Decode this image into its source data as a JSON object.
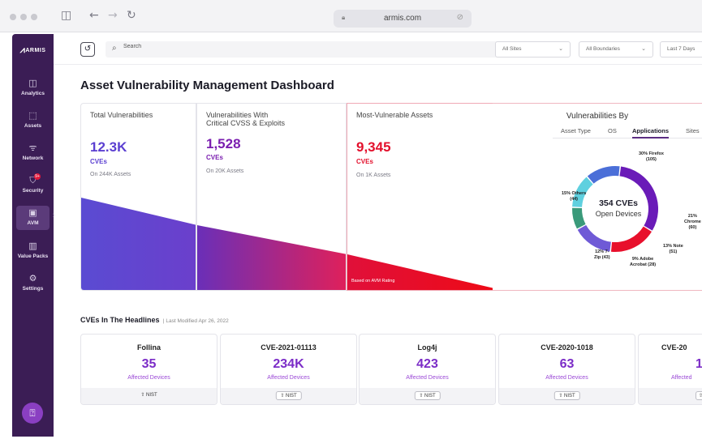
{
  "browser": {
    "url": "armis.com"
  },
  "sidebar": {
    "logo": "ARMIS",
    "items": [
      {
        "label": "Analytics",
        "icon": "chart-icon",
        "glyph": "◫"
      },
      {
        "label": "Assets",
        "icon": "assets-icon",
        "glyph": "⬚"
      },
      {
        "label": "Network",
        "icon": "wifi-icon",
        "glyph": "ᯤ"
      },
      {
        "label": "Security",
        "icon": "shield-icon",
        "glyph": "⛉",
        "badge": "9+"
      },
      {
        "label": "AVM",
        "icon": "avm-icon",
        "glyph": "▣",
        "active": true
      },
      {
        "label": "Value Packs",
        "icon": "packs-icon",
        "glyph": "▥"
      },
      {
        "label": "Settings",
        "icon": "gear-icon",
        "glyph": "⚙"
      }
    ]
  },
  "filters": {
    "search_placeholder": "Search",
    "sites": "All Sites",
    "boundaries": "All Boundaries",
    "range": "Last 7 Days"
  },
  "page": {
    "title": "Asset Vulnerability Management Dashboard"
  },
  "stats": {
    "total": {
      "title": "Total Vulnerabilities",
      "value": "12.3K",
      "unit": "CVEs",
      "sub": "On 244K Assets"
    },
    "critical": {
      "title_line1": "Vulnerabilities With",
      "title_line2": "Critical CVSS & Exploits",
      "value": "1,528",
      "unit": "CVEs",
      "sub": "On 20K Assets"
    },
    "most": {
      "title": "Most-Vulnerable Assets",
      "value": "9,345",
      "unit": "CVEs",
      "sub": "On 1K Assets",
      "note": "Based on AVM Rating"
    }
  },
  "vuln_by": {
    "title": "Vulnerabilities By",
    "tabs": [
      "Asset Type",
      "OS",
      "Applications",
      "Sites"
    ],
    "selected_tab": "Applications",
    "center_value": "354 CVEs",
    "center_label": "Open Devices",
    "labels": {
      "firefox": [
        "30% Firefox",
        "(105)"
      ],
      "others": [
        "15% Others",
        "(44)"
      ],
      "chrome": [
        "21%",
        "Chrome",
        "(60)"
      ],
      "note": [
        "13% Note",
        "(51)"
      ],
      "adobe": [
        "9% Adobe",
        "Acrobat (28)"
      ],
      "zip": [
        "12% 7-",
        "Zip (43)"
      ]
    },
    "colors": {
      "firefox": "#6a1bb8",
      "chrome": "#e8102c",
      "note": "#6f5ad6",
      "adobe": "#3a9a7a",
      "zip": "#5fd0df",
      "others": "#4b6fd8"
    }
  },
  "chart_data": {
    "type": "pie",
    "title": "Vulnerabilities By",
    "categories": [
      "Firefox",
      "Chrome",
      "Note",
      "Adobe Acrobat",
      "7-Zip",
      "Others"
    ],
    "values": [
      105,
      60,
      51,
      28,
      43,
      44
    ],
    "percentages": [
      30,
      21,
      13,
      9,
      12,
      15
    ]
  },
  "headlines": {
    "title": "CVEs In The Headlines",
    "modified": "Last Modified Apr 26, 2022",
    "cards": [
      {
        "name": "Follina",
        "value": "35",
        "label": "Affected Devices",
        "source": "NIST"
      },
      {
        "name": "CVE-2021-01113",
        "value": "234K",
        "label": "Affected Devices",
        "source": "NIST"
      },
      {
        "name": "Log4j",
        "value": "423",
        "label": "Affected Devices",
        "source": "NIST"
      },
      {
        "name": "CVE-2020-1018",
        "value": "63",
        "label": "Affected Devices",
        "source": "NIST"
      },
      {
        "name": "CVE-20",
        "value": "1",
        "label": "Affected",
        "source": ""
      }
    ]
  }
}
